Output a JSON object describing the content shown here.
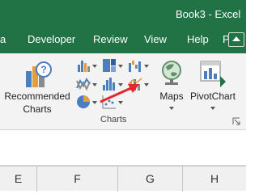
{
  "window": {
    "title": "Book3  -  Excel"
  },
  "tabs": [
    {
      "label": "a"
    },
    {
      "label": "Developer"
    },
    {
      "label": "Review"
    },
    {
      "label": "View"
    },
    {
      "label": "Help"
    },
    {
      "label": "Pow"
    }
  ],
  "ribbon": {
    "recommended_charts": {
      "line1": "Recommended",
      "line2": "Charts"
    },
    "maps": "Maps",
    "pivot_chart": "PivotChart",
    "group_label": "Charts"
  },
  "columns": [
    {
      "label": "E"
    },
    {
      "label": "F"
    },
    {
      "label": "G"
    },
    {
      "label": "H"
    }
  ],
  "colors": {
    "excel_green": "#217346",
    "ribbon_bg": "#f3f3f3",
    "annotation_arrow": "#e0282e"
  },
  "icons": {
    "recommended_charts": "recommended-charts-icon",
    "column_chart": "column-chart-icon",
    "hierarchy_chart": "hierarchy-chart-icon",
    "waterfall_chart": "waterfall-chart-icon",
    "line_chart": "line-chart-icon",
    "statistic_chart": "statistic-chart-icon",
    "combo_chart": "combo-chart-icon",
    "pie_chart": "pie-chart-icon",
    "scatter_chart": "scatter-chart-icon",
    "maps": "globe-icon",
    "pivot_chart": "pivotchart-icon",
    "dialog_launcher": "dialog-launcher-icon",
    "annotation": "red-arrow-annotation"
  }
}
